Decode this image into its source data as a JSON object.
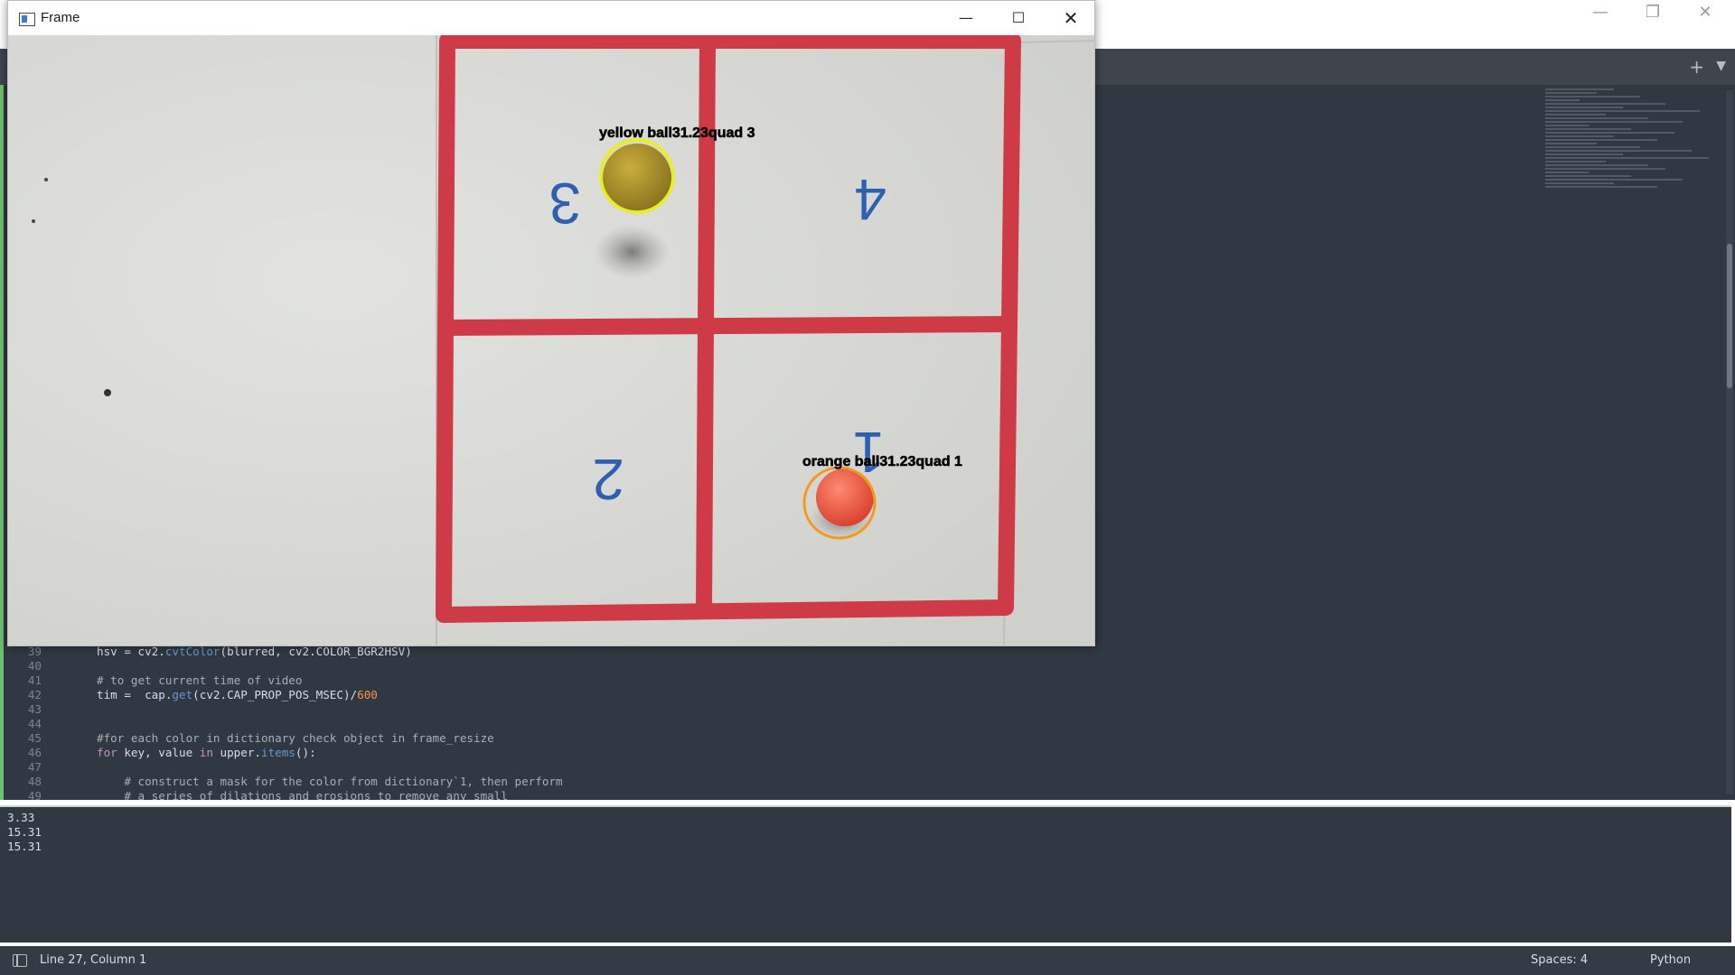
{
  "editor": {
    "code_lines": [
      {
        "num": "39",
        "text": "    hsv = cv2.cvtColor(blurred, cv2.COLOR_BGR2HSV)"
      },
      {
        "num": "40",
        "text": ""
      },
      {
        "num": "41",
        "text": "    # to get current time of video"
      },
      {
        "num": "42",
        "text": "    tim =  cap.get(cv2.CAP_PROP_POS_MSEC)/600"
      },
      {
        "num": "43",
        "text": ""
      },
      {
        "num": "44",
        "text": ""
      },
      {
        "num": "45",
        "text": "    #for each color in dictionary check object in frame_resize"
      },
      {
        "num": "46",
        "text": "    for key, value in upper.items():"
      },
      {
        "num": "47",
        "text": ""
      },
      {
        "num": "48",
        "text": "        # construct a mask for the color from dictionary`1, then perform"
      },
      {
        "num": "49",
        "text": "        # a series of dilations and erosions to remove any small"
      }
    ]
  },
  "console": {
    "output": [
      "3.33",
      "15.31",
      "15.31"
    ]
  },
  "status": {
    "position": "Line 27, Column 1",
    "spaces": "Spaces: 4",
    "language": "Python"
  },
  "frame_window": {
    "title": "Frame",
    "labels": {
      "yellow": "yellow ball31.23quad 3",
      "orange": "orange ball31.23quad 1"
    },
    "quadrant_numbers": [
      "3",
      "4",
      "2",
      "1"
    ],
    "colors": {
      "tape_red": "#cf3a47",
      "tile": "#d9dad7",
      "yellow_ball": "#b89a2c",
      "yellow_circle": "#e8f01a",
      "orange_ball": "#ee5a45",
      "orange_circle": "#f39a1c",
      "digit_blue": "#2f5fb0"
    }
  }
}
